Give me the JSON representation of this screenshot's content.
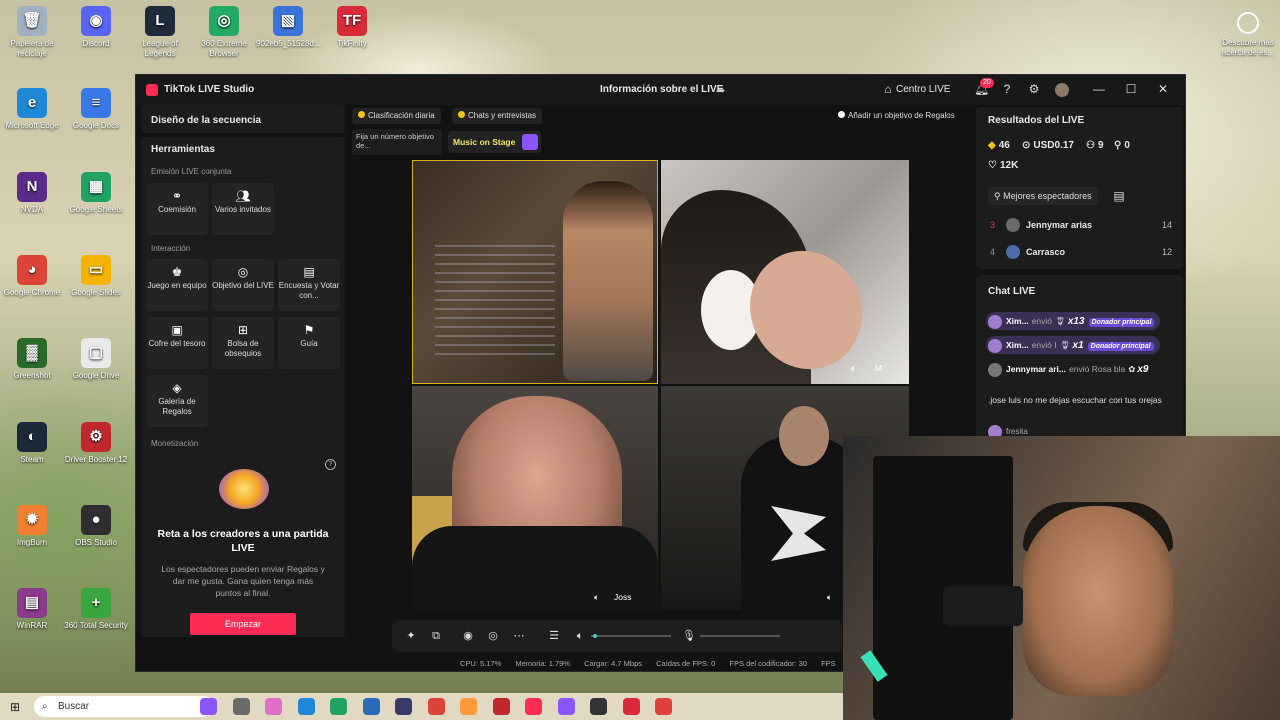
{
  "desktop": {
    "icons": [
      {
        "label": "Papelera de reciclaje",
        "glyph": "🗑",
        "color": "#9fb0c0"
      },
      {
        "label": "Discord",
        "glyph": "◉",
        "color": "#5865f2"
      },
      {
        "label": "League of Legends",
        "glyph": "L",
        "color": "#1e2a3a"
      },
      {
        "label": "360 Extreme Browser",
        "glyph": "◎",
        "color": "#22aa66"
      },
      {
        "label": "902eb5_51528d...",
        "glyph": "▧",
        "color": "#3b74d8"
      },
      {
        "label": "TikFinity",
        "glyph": "TF",
        "color": "#d92a3a"
      },
      {
        "label": "Microsoft Edge",
        "glyph": "e",
        "color": "#1e88d6"
      },
      {
        "label": "Google Docs",
        "glyph": "≡",
        "color": "#3b78e7"
      },
      {
        "label": "NVDA",
        "glyph": "N",
        "color": "#5a2a8a"
      },
      {
        "label": "Google Sheets",
        "glyph": "▦",
        "color": "#21a366"
      },
      {
        "label": "Google Chrome",
        "glyph": "◕",
        "color": "#db4437"
      },
      {
        "label": "Google Slides",
        "glyph": "▭",
        "color": "#f4b400"
      },
      {
        "label": "Greenshot",
        "glyph": "▓",
        "color": "#2a6a2a"
      },
      {
        "label": "Google Drive",
        "glyph": "▢",
        "color": "#e8e8e8"
      },
      {
        "label": "Steam",
        "glyph": "◐",
        "color": "#1b2838"
      },
      {
        "label": "Driver Booster 12",
        "glyph": "⚙",
        "color": "#c0282d"
      },
      {
        "label": "ImgBurn",
        "glyph": "✹",
        "color": "#f08030"
      },
      {
        "label": "OBS Studio",
        "glyph": "●",
        "color": "#302e31"
      },
      {
        "label": "WinRAR",
        "glyph": "▤",
        "color": "#8a3a8a"
      },
      {
        "label": "360 Total Security",
        "glyph": "+",
        "color": "#3aa640"
      }
    ],
    "right_label": "Descubre más acerca de es..."
  },
  "window": {
    "app_title": "TikTok LIVE Studio",
    "center_title": "Información sobre el LIVE",
    "centro_live": "Centro LIVE",
    "notif_count": "20"
  },
  "left": {
    "section_title": "Diseño de la secuencia",
    "tools_title": "Herramientas",
    "group1": "Emisión LIVE conjunta",
    "group1_items": [
      "Coemisión",
      "Varios invitados"
    ],
    "group2": "Interacción",
    "group2_items": [
      "Juego en equipo",
      "Objetivo del LIVE",
      "Encuesta y Votar con...",
      "Cofre del tesoro",
      "Bolsa de obsequios",
      "Guía",
      "Galería de Regalos"
    ],
    "group3": "Monetización",
    "promo_title": "Reta a los creadores a una partida LIVE",
    "promo_text": "Los espectadores pueden enviar Regalos y dar me gusta. Gana quien tenga más puntos al final.",
    "promo_button": "Empezar"
  },
  "center": {
    "chip1": "Clasificación diaria",
    "chip2": "Chats y entrevistas",
    "goal_chip": "Añadir un objetivo de Regalos",
    "goal_tile": "Fija un número objetivo de...",
    "music": "Music on Stage",
    "video2_label": "M",
    "video3_label": "Joss",
    "status": {
      "cpu": "CPU: 5.17%",
      "mem": "Memoria: 1.79%",
      "load": "Cargar: 4.7 Mbps",
      "drops": "Caídas de FPS: 0",
      "fps": "FPS del codificador: 30",
      "fps_trunc": "FPS"
    },
    "volume_level": 0.02,
    "mic_level": 0.0
  },
  "right": {
    "results_title": "Resultados del LIVE",
    "stats": {
      "diamonds": "46",
      "usd": "USD0.17",
      "viewers": "9",
      "new": "0",
      "likes": "12K"
    },
    "best_button": "Mejores espectadores",
    "ranking": [
      {
        "rank": "3",
        "name": "Jennymar arias",
        "score": "14"
      },
      {
        "rank": "4",
        "name": "Carrasco",
        "score": "12"
      }
    ],
    "chat_title": "Chat LIVE",
    "chat": [
      {
        "name": "Xim...",
        "action": "envió",
        "mult": "x13",
        "tag": "Donador principal"
      },
      {
        "name": "Xim...",
        "action": "envió I",
        "mult": "x1",
        "tag": "Donador principal"
      },
      {
        "name": "Jennymar ari...",
        "action": "envió Rosa bla",
        "mult": "x9",
        "tag": ""
      }
    ],
    "message": ".jose luis no me dejas escuchar con tus orejas",
    "last_name": "fresita"
  },
  "taskbar": {
    "search": "Buscar"
  }
}
